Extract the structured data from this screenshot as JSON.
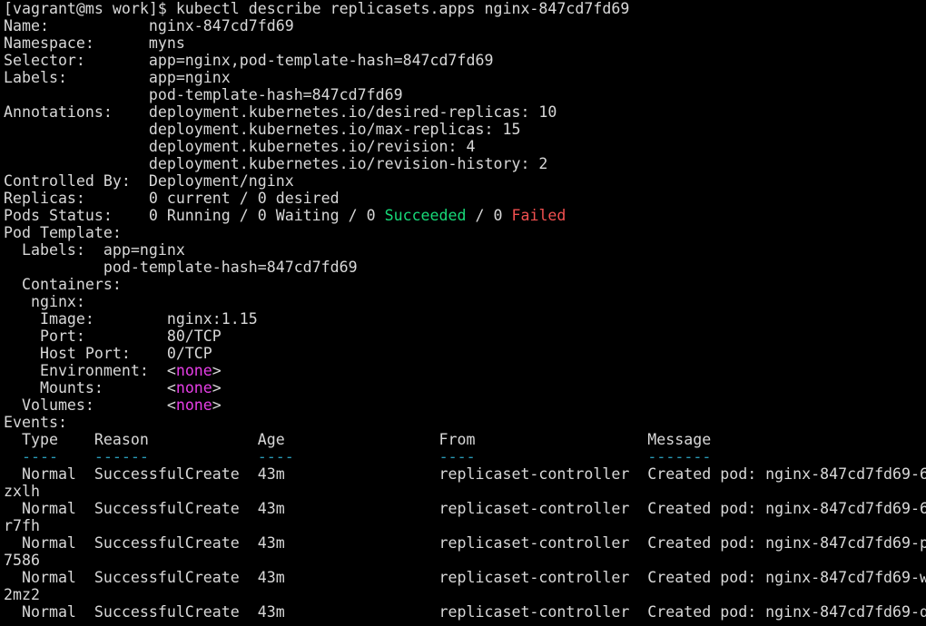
{
  "terminal": {
    "colors": {
      "background": "#000000",
      "foreground": "#d8d8d8",
      "succeeded": "#17d978",
      "failed": "#f25050",
      "none_value": "#e73ee7",
      "underline": "#2a9bb8"
    },
    "lines": [
      [
        {
          "text": "[vagrant@ms work]$ kubectl describe replicasets.apps nginx-847cd7fd69"
        }
      ],
      [
        {
          "text": "Name:           nginx-847cd7fd69"
        }
      ],
      [
        {
          "text": "Namespace:      myns"
        }
      ],
      [
        {
          "text": "Selector:       app=nginx,pod-template-hash=847cd7fd69"
        }
      ],
      [
        {
          "text": "Labels:         app=nginx"
        }
      ],
      [
        {
          "text": "                pod-template-hash=847cd7fd69"
        }
      ],
      [
        {
          "text": "Annotations:    deployment.kubernetes.io/desired-replicas: 10"
        }
      ],
      [
        {
          "text": "                deployment.kubernetes.io/max-replicas: 15"
        }
      ],
      [
        {
          "text": "                deployment.kubernetes.io/revision: 4"
        }
      ],
      [
        {
          "text": "                deployment.kubernetes.io/revision-history: 2"
        }
      ],
      [
        {
          "text": "Controlled By:  Deployment/nginx"
        }
      ],
      [
        {
          "text": "Replicas:       0 current / 0 desired"
        }
      ],
      [
        {
          "text": "Pods Status:    0 Running / 0 Waiting / 0 "
        },
        {
          "text": "Succeeded",
          "color": "green"
        },
        {
          "text": " / 0 "
        },
        {
          "text": "Failed",
          "color": "red"
        }
      ],
      [
        {
          "text": "Pod Template:"
        }
      ],
      [
        {
          "text": "  Labels:  app=nginx"
        }
      ],
      [
        {
          "text": "           pod-template-hash=847cd7fd69"
        }
      ],
      [
        {
          "text": "  Containers:"
        }
      ],
      [
        {
          "text": "   nginx:"
        }
      ],
      [
        {
          "text": "    Image:        nginx:1.15"
        }
      ],
      [
        {
          "text": "    Port:         80/TCP"
        }
      ],
      [
        {
          "text": "    Host Port:    0/TCP"
        }
      ],
      [
        {
          "text": "    Environment:  <"
        },
        {
          "text": "none",
          "color": "magenta"
        },
        {
          "text": ">"
        }
      ],
      [
        {
          "text": "    Mounts:       <"
        },
        {
          "text": "none",
          "color": "magenta"
        },
        {
          "text": ">"
        }
      ],
      [
        {
          "text": "  Volumes:        <"
        },
        {
          "text": "none",
          "color": "magenta"
        },
        {
          "text": ">"
        }
      ],
      [
        {
          "text": "Events:"
        }
      ],
      [
        {
          "text": "  Type    Reason            Age                 From                   Message"
        }
      ],
      [
        {
          "text": "  "
        },
        {
          "text": "----",
          "color": "cyan"
        },
        {
          "text": "    "
        },
        {
          "text": "------",
          "color": "cyan"
        },
        {
          "text": "            "
        },
        {
          "text": "----",
          "color": "cyan"
        },
        {
          "text": "                "
        },
        {
          "text": "----",
          "color": "cyan"
        },
        {
          "text": "                   "
        },
        {
          "text": "-------",
          "color": "cyan"
        }
      ],
      [
        {
          "text": "  Normal  SuccessfulCreate  43m                 replicaset-controller  Created pod: nginx-847cd7fd69-6"
        }
      ],
      [
        {
          "text": "zxlh"
        }
      ],
      [
        {
          "text": "  Normal  SuccessfulCreate  43m                 replicaset-controller  Created pod: nginx-847cd7fd69-6"
        }
      ],
      [
        {
          "text": "r7fh"
        }
      ],
      [
        {
          "text": "  Normal  SuccessfulCreate  43m                 replicaset-controller  Created pod: nginx-847cd7fd69-p"
        }
      ],
      [
        {
          "text": "7586"
        }
      ],
      [
        {
          "text": "  Normal  SuccessfulCreate  43m                 replicaset-controller  Created pod: nginx-847cd7fd69-w"
        }
      ],
      [
        {
          "text": "2mz2"
        }
      ],
      [
        {
          "text": "  Normal  SuccessfulCreate  43m                 replicaset-controller  Created pod: nginx-847cd7fd69-d"
        }
      ]
    ]
  }
}
